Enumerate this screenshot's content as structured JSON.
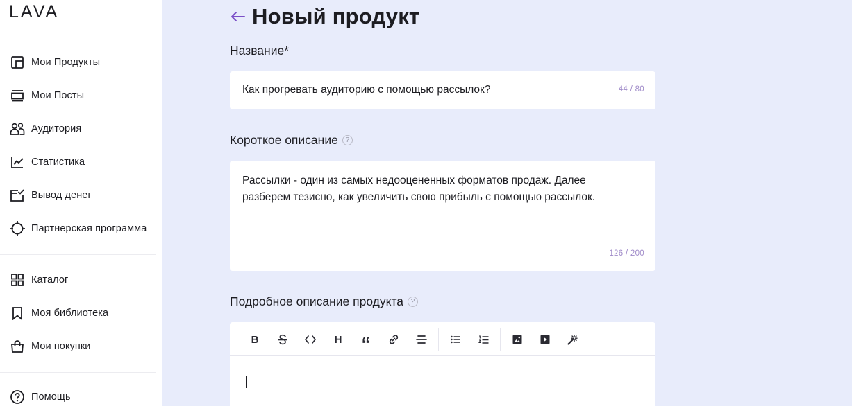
{
  "brand": {
    "logo_text": "LAVA"
  },
  "sidebar": {
    "items": [
      {
        "label": "Мои Продукты",
        "icon": "products-icon"
      },
      {
        "label": "Мои Посты",
        "icon": "posts-icon"
      },
      {
        "label": "Аудитория",
        "icon": "audience-icon"
      },
      {
        "label": "Статистика",
        "icon": "stats-icon"
      },
      {
        "label": "Вывод денег",
        "icon": "withdraw-icon"
      },
      {
        "label": "Партнерская программа",
        "icon": "target-icon"
      },
      {
        "label": "Каталог",
        "icon": "catalog-icon"
      },
      {
        "label": "Моя библиотека",
        "icon": "bookmark-icon"
      },
      {
        "label": "Мои покупки",
        "icon": "bag-icon"
      },
      {
        "label": "Помощь",
        "icon": "help-circle-icon"
      }
    ]
  },
  "page": {
    "title": "Новый продукт"
  },
  "form": {
    "name": {
      "label": "Название*",
      "value": "Как прогревать аудиторию с помощью рассылок?",
      "counter": "44 / 80"
    },
    "short": {
      "label": "Короткое описание",
      "value_line1": "Рассылки - один из самых недооцененных форматов продаж. Далее",
      "value_line2": "разберем тезисно, как увеличить свою прибыль с помощью рассылок.",
      "counter": "126 / 200"
    },
    "full": {
      "label": "Подробное описание продукта"
    },
    "help_mark": "?"
  },
  "toolbar": {
    "bold": "B",
    "heading": "H",
    "quote": "“"
  }
}
